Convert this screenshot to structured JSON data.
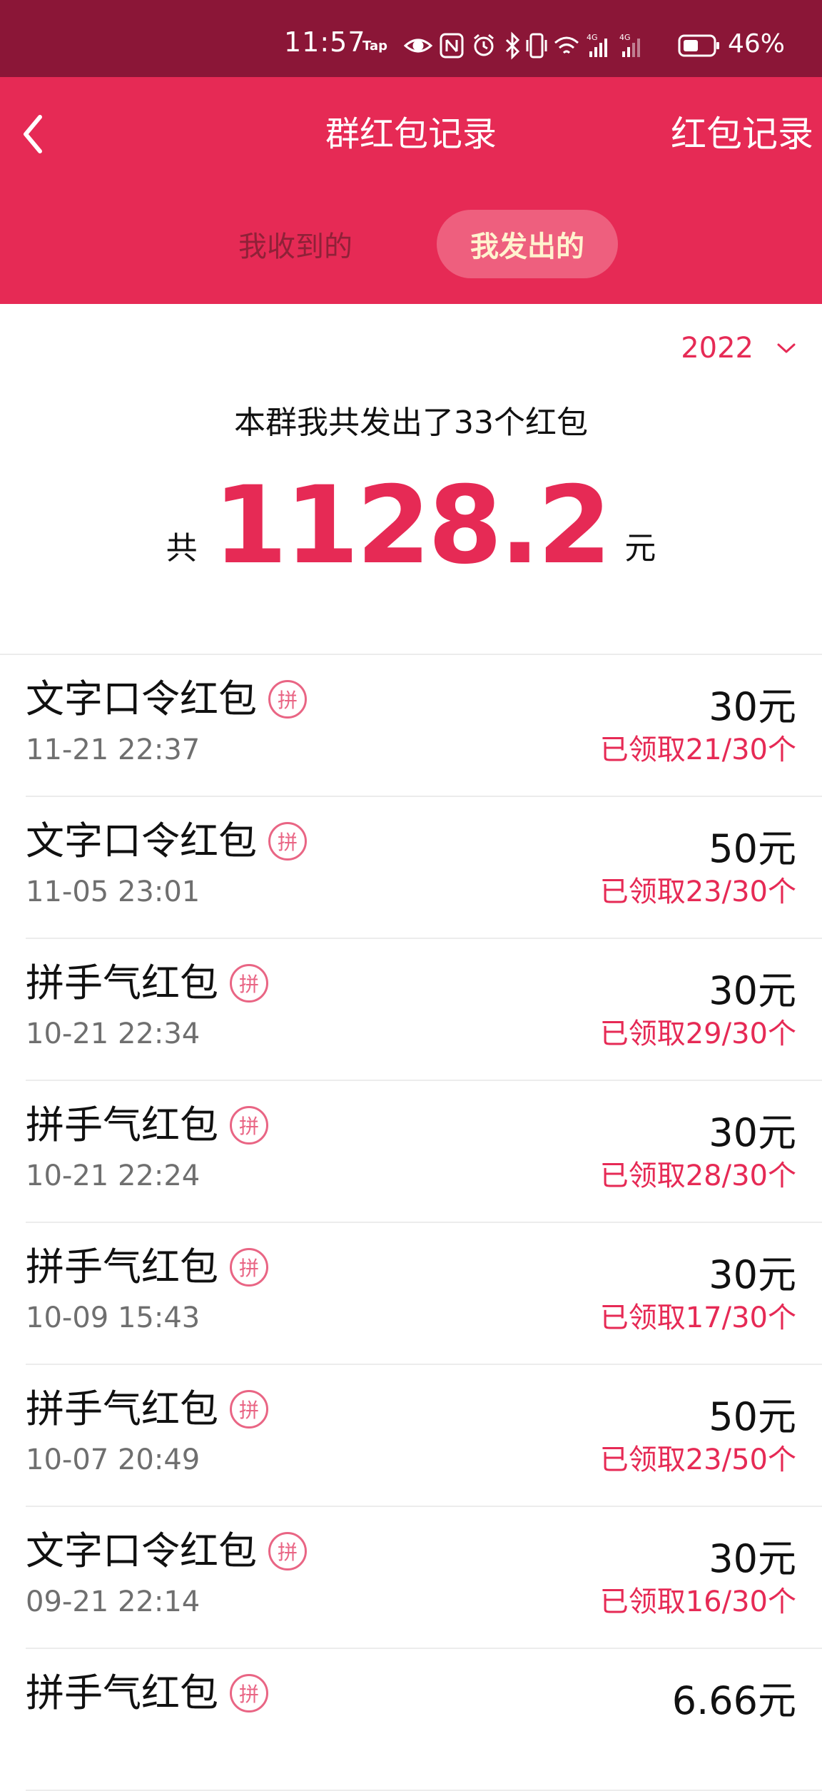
{
  "status_bar": {
    "time": "11:57",
    "tap_label": "Tap",
    "battery_percent": "46%",
    "icons": [
      "eye-icon",
      "nfc-icon",
      "alarm-icon",
      "bluetooth-icon",
      "vibrate-icon",
      "wifi-icon",
      "signal-4g-icon",
      "signal-4g-icon",
      "battery-icon"
    ]
  },
  "header": {
    "title": "群红包记录",
    "right_link": "红包记录",
    "background_color": "#e62a55"
  },
  "tabs": {
    "received": "我收到的",
    "sent": "我发出的",
    "active": "sent"
  },
  "summary": {
    "year": "2022",
    "line": "本群我共发出了33个红包",
    "total_prefix": "共",
    "total_amount": "1128.2",
    "total_unit": "元"
  },
  "badge_label": "拼",
  "records": [
    {
      "name": "文字口令红包",
      "time": "11-21 22:37",
      "amount": "30元",
      "claimed": "已领取21/30个"
    },
    {
      "name": "文字口令红包",
      "time": "11-05 23:01",
      "amount": "50元",
      "claimed": "已领取23/30个"
    },
    {
      "name": "拼手气红包",
      "time": "10-21 22:34",
      "amount": "30元",
      "claimed": "已领取29/30个"
    },
    {
      "name": "拼手气红包",
      "time": "10-21 22:24",
      "amount": "30元",
      "claimed": "已领取28/30个"
    },
    {
      "name": "拼手气红包",
      "time": "10-09 15:43",
      "amount": "30元",
      "claimed": "已领取17/30个"
    },
    {
      "name": "拼手气红包",
      "time": "10-07 20:49",
      "amount": "50元",
      "claimed": "已领取23/50个"
    },
    {
      "name": "文字口令红包",
      "time": "09-21 22:14",
      "amount": "30元",
      "claimed": "已领取16/30个"
    },
    {
      "name": "拼手气红包",
      "time": "",
      "amount": "6.66元",
      "claimed": ""
    }
  ]
}
